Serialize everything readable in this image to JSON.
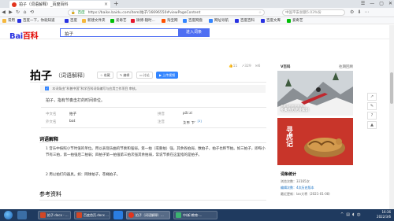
{
  "browser": {
    "tab_title": "拍子（词语解释）_百度百科",
    "new_tab": "+",
    "window_controls": [
      "☰",
      "—",
      "▢",
      "✕"
    ],
    "security_label": "百度",
    "url": "https://baike.baidu.com/item/拍子/16696550#viewPageContent",
    "side_search": "中国平安总额5.03%份",
    "bookmarks": [
      "常用",
      "百度一下，你就知道",
      "百度",
      "新建文件夹",
      "爱奇艺",
      "微博-随时...",
      "淘宝网",
      "百度网盘",
      "网址导航",
      "百度百科",
      "百度文库",
      "爱奇艺"
    ]
  },
  "header": {
    "logo_bai": "Bai",
    "logo_du": "百科",
    "search_value": "拍子",
    "search_button": "进入词条"
  },
  "article": {
    "title": "拍子",
    "subtitle": "（词语解释）",
    "buttons": [
      "收藏",
      "编辑",
      "讨论",
      "上传视频"
    ],
    "stats": [
      "11",
      "329",
      "6"
    ],
    "notice_text": "本词条由“科普中国”科学百科词条编写与应用工作项目 审核。",
    "notice_link": "审核",
    "summary": "拍子，指有节奏击打的时间单位。",
    "info": [
      {
        "k": "中文名",
        "v": "拍子"
      },
      {
        "k": "拼音",
        "v": "pāi zi"
      },
      {
        "k": "外文名",
        "v": "bat"
      },
      {
        "k": "注音",
        "v": "ㄆㄞ ㄗ˙"
      }
    ],
    "ref_mark": "[1]",
    "section_h": "词语解释",
    "p1": "1 音乐中按照小节时值的单位。用以表现乐曲的节奏和强弱。第一拍（或重拍）强，其余各拍弱，数拍子，拍子也称节拍。如三拍子，即每小节有三拍，第一拍强后二拍弱；四拍子第一拍强第三拍次强其余拍弱，常说节奏在这里指的是拍子。",
    "p2": "2 用以拍打的器具。如：网球拍子，苍蝇拍子。",
    "ref_h": "参考资料"
  },
  "sidebar": {
    "brand": "V百科",
    "more": "往期回顾",
    "card1_caption": "冬奥会历史冷知识",
    "card1_small": "冬奥会的历史有多久",
    "card2_vertical": "寻虎记",
    "stats_title": "词条统计",
    "stats_rows": [
      "浏览次数：33165次",
      "编辑次数：4次历史版本",
      "最近更新：lan大将（2021-01-08）"
    ]
  },
  "taskbar": {
    "items": [
      "拍子.docx - ...",
      "百度首页.docx ...",
      "拍子（词语解释）...",
      "中(新)教育-..."
    ],
    "time": "16:36",
    "date": "2022/3/6"
  }
}
